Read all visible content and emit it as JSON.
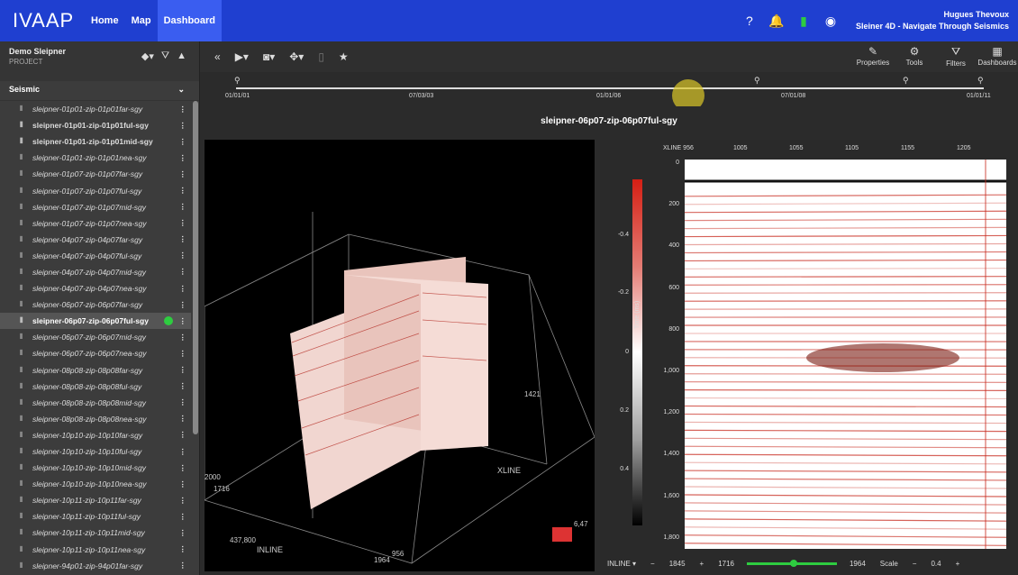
{
  "app": {
    "logo": "IVAAP",
    "nav": [
      "Home",
      "Map",
      "Dashboard"
    ],
    "user": "Hugues Thevoux",
    "project_context": "Sleiner 4D - Navigate Through Seismics"
  },
  "sidebar": {
    "project_name": "Demo Sleipner",
    "project_label": "PROJECT",
    "section": "Seismic",
    "items": [
      "sleipner-01p01-zip-01p01far-sgy",
      "sleipner-01p01-zip-01p01ful-sgy",
      "sleipner-01p01-zip-01p01mid-sgy",
      "sleipner-01p01-zip-01p01nea-sgy",
      "sleipner-01p07-zip-01p07far-sgy",
      "sleipner-01p07-zip-01p07ful-sgy",
      "sleipner-01p07-zip-01p07mid-sgy",
      "sleipner-01p07-zip-01p07nea-sgy",
      "sleipner-04p07-zip-04p07far-sgy",
      "sleipner-04p07-zip-04p07ful-sgy",
      "sleipner-04p07-zip-04p07mid-sgy",
      "sleipner-04p07-zip-04p07nea-sgy",
      "sleipner-06p07-zip-06p07far-sgy",
      "sleipner-06p07-zip-06p07ful-sgy",
      "sleipner-06p07-zip-06p07mid-sgy",
      "sleipner-06p07-zip-06p07nea-sgy",
      "sleipner-08p08-zip-08p08far-sgy",
      "sleipner-08p08-zip-08p08ful-sgy",
      "sleipner-08p08-zip-08p08mid-sgy",
      "sleipner-08p08-zip-08p08nea-sgy",
      "sleipner-10p10-zip-10p10far-sgy",
      "sleipner-10p10-zip-10p10ful-sgy",
      "sleipner-10p10-zip-10p10mid-sgy",
      "sleipner-10p10-zip-10p10nea-sgy",
      "sleipner-10p11-zip-10p11far-sgy",
      "sleipner-10p11-zip-10p11ful-sgy",
      "sleipner-10p11-zip-10p11mid-sgy",
      "sleipner-10p11-zip-10p11nea-sgy",
      "sleipner-94p01-zip-94p01far-sgy"
    ],
    "bold_items": [
      1,
      2,
      13
    ]
  },
  "toolbar": {
    "right": [
      "Properties",
      "Tools",
      "Filters",
      "Dashboards"
    ]
  },
  "timeline": {
    "labels": [
      "01/01/01",
      "07/03/03",
      "01/01/06",
      "07/01/08",
      "01/01/11"
    ]
  },
  "dataset_title": "sleipner-06p07-zip-06p07ful-sgy",
  "view3d": {
    "labels": [
      "INLINE",
      "XLINE",
      "2000",
      "1716",
      "437,800",
      "1964",
      "956",
      "1421",
      "6,47"
    ]
  },
  "panel2d": {
    "xline_label": "XLINE 956",
    "x_ticks": [
      "1005",
      "1055",
      "1105",
      "1155",
      "1205"
    ],
    "y_ticks": [
      "0",
      "200",
      "400",
      "600",
      "800",
      "1,000",
      "1,200",
      "1,400",
      "1,600",
      "1,800"
    ],
    "colorbar": [
      "-0.4",
      "-0.2",
      "0",
      "0.2",
      "0.4"
    ],
    "axis_label": "Time (ms)"
  },
  "bottom": {
    "mode": "INLINE",
    "value": "1845",
    "range_min": "1716",
    "range_max": "1964",
    "scale_label": "Scale",
    "scale": "0.4"
  }
}
